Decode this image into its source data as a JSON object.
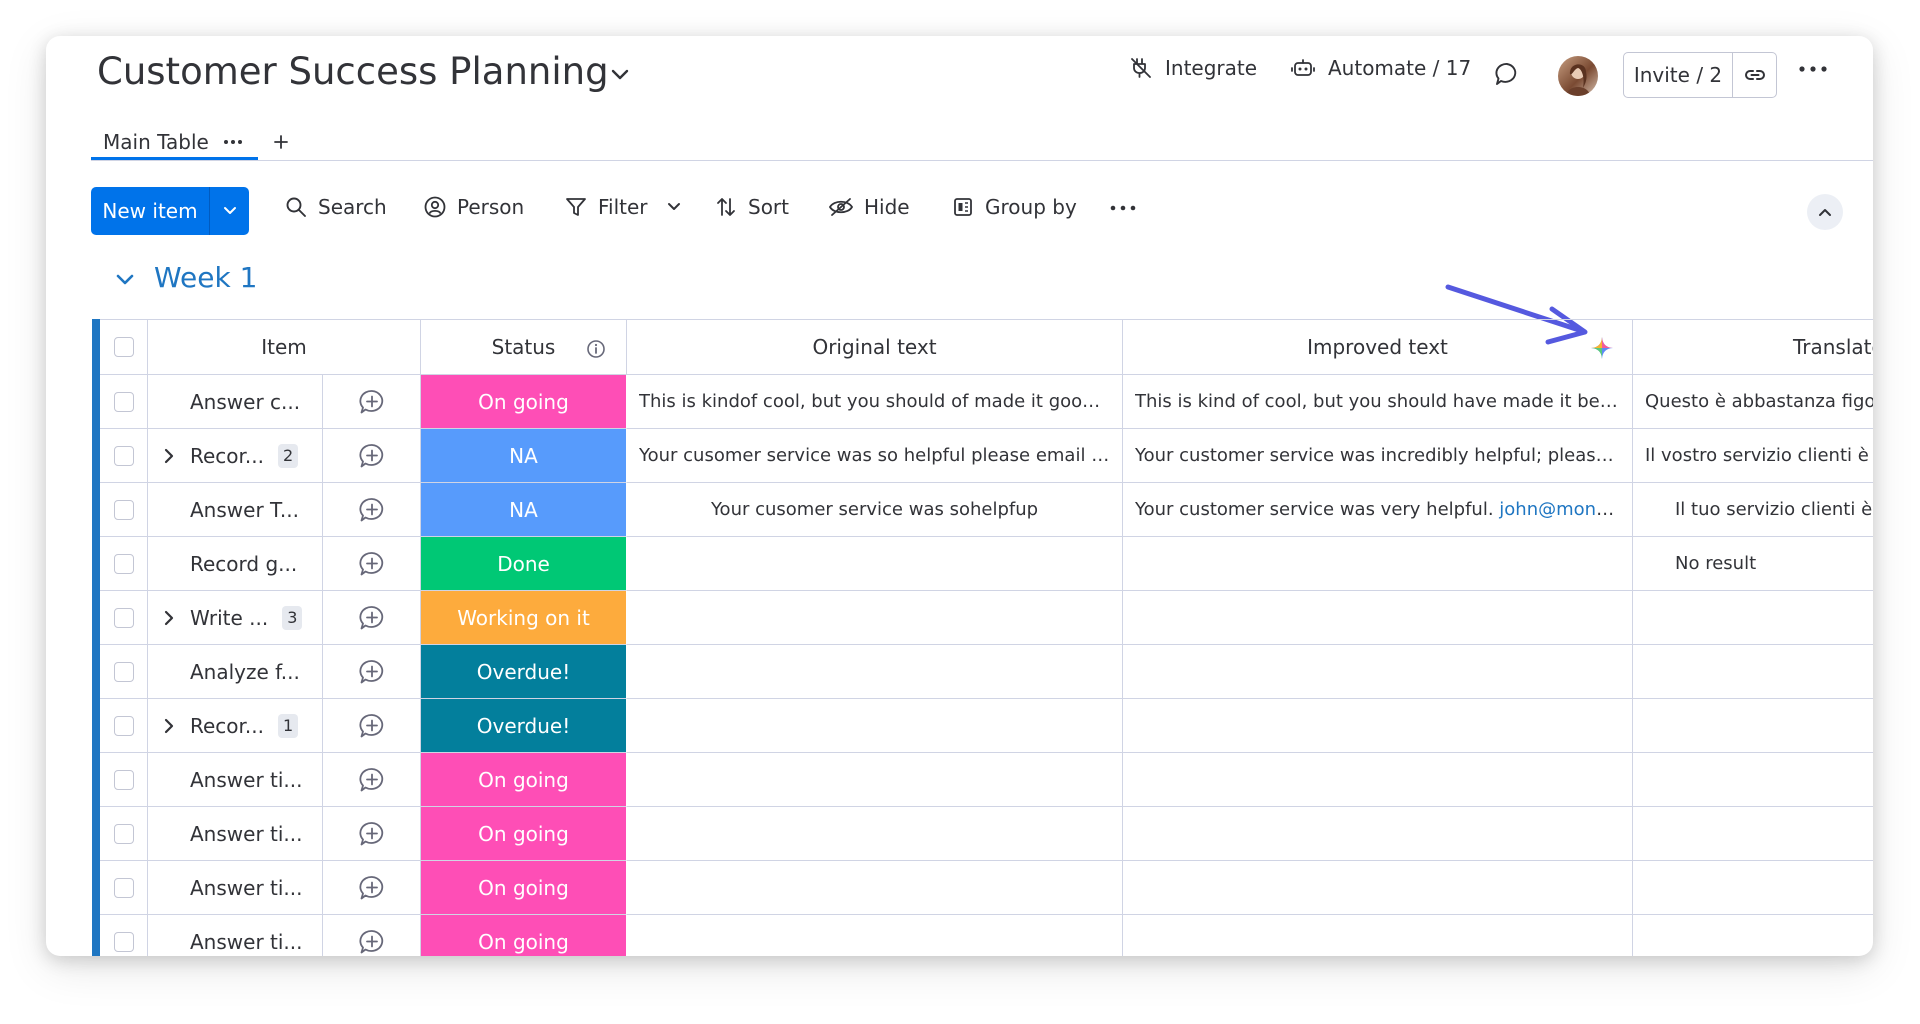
{
  "board": {
    "title": "Customer Success Planning",
    "header": {
      "integrate_label": "Integrate",
      "automate_label": "Automate / 17",
      "invite_label": "Invite / 2"
    },
    "views": {
      "main_tab_label": "Main Table"
    }
  },
  "toolbar": {
    "new_item_label": "New item",
    "search_label": "Search",
    "person_label": "Person",
    "filter_label": "Filter",
    "sort_label": "Sort",
    "hide_label": "Hide",
    "group_by_label": "Group by"
  },
  "group": {
    "title": "Week 1",
    "color": "#1f76c2",
    "columns": {
      "item": "Item",
      "status": "Status",
      "original": "Original text",
      "improved": "Improved text",
      "translate": "Translate"
    },
    "rows": [
      {
        "item": "Answer c...",
        "subitems": "",
        "status": "On going",
        "status_color": "#fe4eb6",
        "original": "This is kindof cool, but you should of made it gooder",
        "improved": "This is kind of cool, but you should have made it better",
        "improved_link": "",
        "translate": "Questo è abbastanza figo,",
        "translate_align": "left"
      },
      {
        "item": "Recor...",
        "subitems": "2",
        "status": "NA",
        "status_color": "#579bfc",
        "original": "Your cusomer service was so helpful please email m...",
        "improved": "Your customer service was incredibly helpful; please s...",
        "improved_link": "",
        "translate": "Il vostro servizio clienti è s",
        "translate_align": "left"
      },
      {
        "item": "Answer T...",
        "subitems": "",
        "status": "NA",
        "status_color": "#579bfc",
        "original": "Your cusomer service was sohelpfup",
        "improved": "Your customer service was very helpful. ",
        "improved_link": "john@mond...",
        "translate": "Il tuo servizio clienti è s",
        "translate_align": "right"
      },
      {
        "item": "Record g...",
        "subitems": "",
        "status": "Done",
        "status_color": "#00c875",
        "original": "",
        "improved": "",
        "improved_link": "",
        "translate": "No result",
        "translate_align": "right"
      },
      {
        "item": "Write ...",
        "subitems": "3",
        "status": "Working on it",
        "status_color": "#fdab3d",
        "original": "",
        "improved": "",
        "improved_link": "",
        "translate": "",
        "translate_align": "left"
      },
      {
        "item": "Analyze f...",
        "subitems": "",
        "status": "Overdue!",
        "status_color": "#037f9c",
        "original": "",
        "improved": "",
        "improved_link": "",
        "translate": "",
        "translate_align": "left"
      },
      {
        "item": "Recor...",
        "subitems": "1",
        "status": "Overdue!",
        "status_color": "#037f9c",
        "original": "",
        "improved": "",
        "improved_link": "",
        "translate": "",
        "translate_align": "left"
      },
      {
        "item": "Answer ti...",
        "subitems": "",
        "status": "On going",
        "status_color": "#fe4eb6",
        "original": "",
        "improved": "",
        "improved_link": "",
        "translate": "",
        "translate_align": "left"
      },
      {
        "item": "Answer ti...",
        "subitems": "",
        "status": "On going",
        "status_color": "#fe4eb6",
        "original": "",
        "improved": "",
        "improved_link": "",
        "translate": "",
        "translate_align": "left"
      },
      {
        "item": "Answer ti...",
        "subitems": "",
        "status": "On going",
        "status_color": "#fe4eb6",
        "original": "",
        "improved": "",
        "improved_link": "",
        "translate": "",
        "translate_align": "left"
      },
      {
        "item": "Answer ti...",
        "subitems": "",
        "status": "On going",
        "status_color": "#fe4eb6",
        "original": "",
        "improved": "",
        "improved_link": "",
        "translate": "",
        "translate_align": "left"
      }
    ]
  },
  "icons": [
    "chevron-down-icon",
    "integrate-icon",
    "robot-icon",
    "chat-bubble-icon",
    "link-icon",
    "more-dots-icon",
    "plus-icon",
    "search-icon",
    "person-icon",
    "filter-icon",
    "sort-icon",
    "eye-hidden-icon",
    "group-by-icon",
    "chevron-up-icon",
    "info-icon",
    "expand-chevron-icon",
    "add-update-icon",
    "ai-sparkle-icon",
    "arrow-annotation-icon"
  ],
  "colors": {
    "primary": "#0073ea",
    "annotation_arrow": "#5559df"
  }
}
